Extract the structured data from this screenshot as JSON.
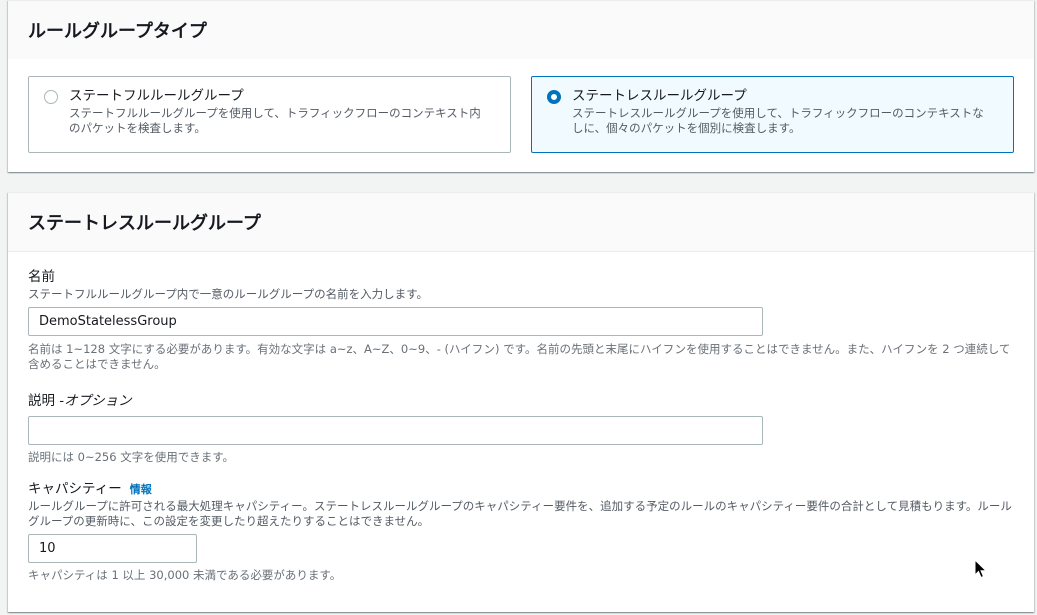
{
  "rule_group_type": {
    "title": "ルールグループタイプ",
    "options": [
      {
        "label": "ステートフルルールグループ",
        "description": "ステートフルルールグループを使用して、トラフィックフローのコンテキスト内のパケットを検査します。",
        "selected": false
      },
      {
        "label": "ステートレスルールグループ",
        "description": "ステートレスルールグループを使用して、トラフィックフローのコンテキストなしに、個々のパケットを個別に検査します。",
        "selected": true
      }
    ]
  },
  "stateless_group": {
    "title": "ステートレスルールグループ",
    "name_field": {
      "label": "名前",
      "description": "ステートフルルールグループ内で一意のルールグループの名前を入力します。",
      "value": "DemoStatelessGroup",
      "constraint": "名前は 1~128 文字にする必要があります。有効な文字は a~z、A~Z、0~9、- (ハイフン) です。名前の先頭と末尾にハイフンを使用することはできません。また、ハイフンを 2 つ連続して含めることはできません。"
    },
    "description_field": {
      "label": "説明 - ",
      "label_optional": "オプション",
      "value": "",
      "constraint": "説明には 0~256 文字を使用できます。"
    },
    "capacity_field": {
      "label": "キャパシティー",
      "info_link": "情報",
      "description": "ルールグループに許可される最大処理キャパシティー。ステートレスルールグループのキャパシティー要件を、追加する予定のルールのキャパシティー要件の合計として見積もります。ルールグループの更新時に、この設定を変更したり超えたりすることはできません。",
      "value": "10",
      "constraint": "キャパシティは 1 以上 30,000 未満である必要があります。"
    }
  },
  "colors": {
    "accent": "#0073bb",
    "selected_bg": "#f1faff"
  }
}
